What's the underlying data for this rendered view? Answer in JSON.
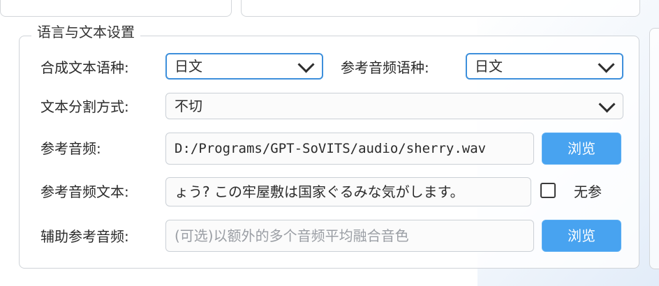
{
  "group": {
    "title": "语言与文本设置"
  },
  "synthesis_language": {
    "label": "合成文本语种:",
    "value": "日文"
  },
  "reference_language": {
    "label": "参考音频语种:",
    "value": "日文"
  },
  "text_split": {
    "label": "文本分割方式:",
    "value": "不切"
  },
  "reference_audio": {
    "label": "参考音频:",
    "value": "D:/Programs/GPT-SoVITS/audio/sherry.wav",
    "button": "浏览"
  },
  "reference_text": {
    "label": "参考音频文本:",
    "value": "ょう? この牢屋敷は国家ぐるみな気がします。",
    "checkbox_label": "无参"
  },
  "aux_audio": {
    "label": "辅助参考音频:",
    "placeholder": "(可选)以额外的多个音频平均融合音色",
    "button": "浏览"
  }
}
